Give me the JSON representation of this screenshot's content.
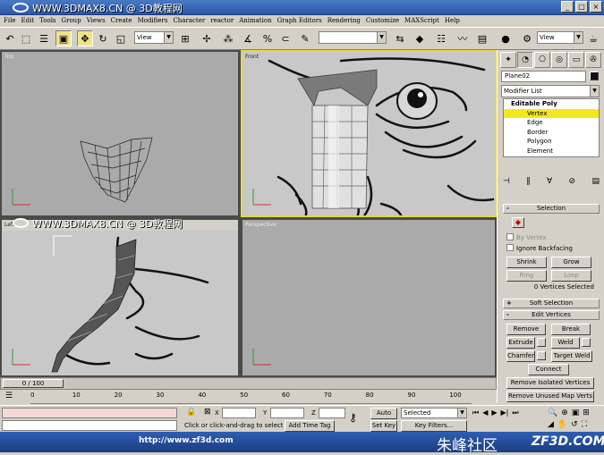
{
  "watermark": {
    "text": "WWW.3DMAX8.CN @ 3D教程网"
  },
  "menu": [
    "File",
    "Edit",
    "Tools",
    "Group",
    "Views",
    "Create",
    "Modifiers",
    "Character",
    "reactor",
    "Animation",
    "Graph Editors",
    "Rendering",
    "Customize",
    "MAXScript",
    "Help"
  ],
  "toolbar": {
    "view_combo": "View",
    "view_combo2": "View",
    "selection_set": ""
  },
  "viewports": {
    "top": "Top",
    "front": "Front",
    "left": "Left",
    "perspective": "Perspective"
  },
  "panel": {
    "object_name": "Plane02",
    "modifier_list": "Modifier List",
    "stack": {
      "root": "Editable Poly",
      "items": [
        "Vertex",
        "Edge",
        "Border",
        "Polygon",
        "Element"
      ]
    },
    "selection": {
      "title": "Selection",
      "by_vertex": "By Vertex",
      "ignore_backfacing": "Ignore Backfacing",
      "shrink": "Shrink",
      "grow": "Grow",
      "ring": "Ring",
      "loop": "Loop",
      "status": "0 Vertices Selected"
    },
    "soft_selection": "Soft Selection",
    "edit_vertices": {
      "title": "Edit Vertices",
      "remove": "Remove",
      "break": "Break",
      "extrude": "Extrude",
      "weld": "Weld",
      "chamfer": "Chamfer",
      "target_weld": "Target Weld",
      "connect": "Connect",
      "remove_isolated": "Remove Isolated Vertices",
      "remove_unused": "Remove Unused Map Verts"
    }
  },
  "timeline": {
    "frame": "0 / 100",
    "ticks": [
      "0",
      "10",
      "20",
      "30",
      "40",
      "50",
      "60",
      "70",
      "80",
      "90",
      "100"
    ]
  },
  "status": {
    "prompt": "Click or click-and-drag to select ob",
    "add_time_tag": "Add Time Tag",
    "x_label": "X",
    "y_label": "Y",
    "z_label": "Z",
    "auto_key": "Auto Key",
    "set_key": "Set Key",
    "key_mode": "Selected",
    "key_filters": "Key Filters..."
  },
  "footer": {
    "url": "http://www.zf3d.com",
    "cn": "朱峰社区",
    "brand": "ZF3D.COM"
  }
}
